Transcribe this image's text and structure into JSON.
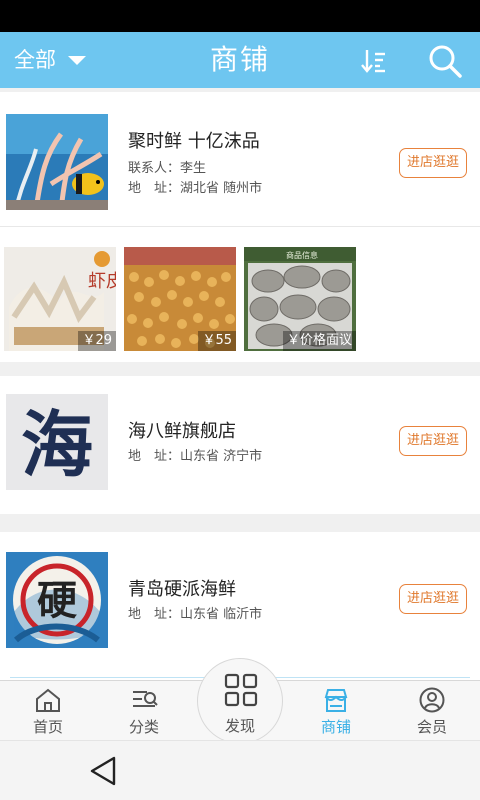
{
  "header": {
    "filter_label": "全部",
    "title": "商铺"
  },
  "icons": {
    "filter": "chevron-down-icon",
    "sort": "sort-icon",
    "search": "search-icon",
    "back": "back-icon"
  },
  "colors": {
    "header_bg": "#6ec6f0",
    "accent_orange": "#e8823c",
    "active_tab": "#3ab0e6"
  },
  "shops": [
    {
      "name": "聚时鲜 十亿沫品",
      "contact_label": "联系人：",
      "contact": "李生",
      "address_label": "地　址：",
      "address": "湖北省 随州市",
      "button": "进店逛逛",
      "products": [
        {
          "price": "￥29",
          "overlay_text": "虾皮"
        },
        {
          "price": "￥55"
        },
        {
          "price": "￥价格面议",
          "overlay_text": "商品信息"
        }
      ]
    },
    {
      "name": "海八鲜旗舰店",
      "address_label": "地　址：",
      "address": "山东省 济宁市",
      "button": "进店逛逛",
      "logo_text": "海"
    },
    {
      "name": "青岛硬派海鲜",
      "address_label": "地　址：",
      "address": "山东省 临沂市",
      "button": "进店逛逛",
      "logo_text": "硬"
    }
  ],
  "tabs": [
    {
      "label": "首页",
      "icon": "home-icon"
    },
    {
      "label": "分类",
      "icon": "category-icon"
    },
    {
      "label": "发现",
      "icon": "grid-icon"
    },
    {
      "label": "商铺",
      "icon": "shop-icon",
      "active": true
    },
    {
      "label": "会员",
      "icon": "user-icon"
    }
  ]
}
